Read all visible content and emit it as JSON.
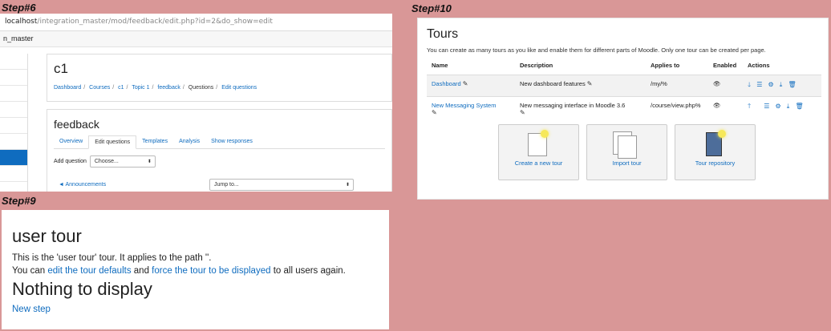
{
  "labels": {
    "step6": "Step#6",
    "step10": "Step#10",
    "step9": "Step#9"
  },
  "step6": {
    "url_host": "localhost",
    "url_path": "/integration_master/mod/feedback/edit.php?id=2&do_show=edit",
    "tab_title": "n_master",
    "course_title": "c1",
    "breadcrumbs": [
      "Dashboard",
      "Courses",
      "c1",
      "Topic 1",
      "feedback",
      "Questions",
      "Edit questions"
    ],
    "activity_title": "feedback",
    "tabs": [
      "Overview",
      "Edit questions",
      "Templates",
      "Analysis",
      "Show responses"
    ],
    "add_question_label": "Add question",
    "add_question_select": "Choose...",
    "prev_link": "◄ Announcements",
    "jump_select": "Jump to..."
  },
  "step10": {
    "title": "Tours",
    "intro": "You can create as many tours as you like and enable them for different parts of Moodle. Only one tour can be created per page.",
    "headers": [
      "Name",
      "Description",
      "Applies to",
      "Enabled",
      "Actions"
    ],
    "rows": [
      {
        "name": "Dashboard",
        "description": "New dashboard features",
        "applies_to": "/my/%"
      },
      {
        "name": "New Messaging System",
        "description": "New messaging interface in Moodle 3.6",
        "applies_to": "/course/view.php%"
      }
    ],
    "buttons": [
      "Create a new tour",
      "Import tour",
      "Tour repository"
    ],
    "icons": {
      "pencil": "pencil-icon",
      "eye": "eye-icon",
      "down": "arrow-down-icon",
      "up": "arrow-up-icon",
      "list": "list-icon",
      "gear": "gear-icon",
      "export": "download-icon",
      "delete": "trash-icon"
    },
    "accent": "#0f6cbf"
  },
  "step9": {
    "title": "user tour",
    "line1": "This is the 'user tour' tour. It applies to the path ''.",
    "line2_pre": "You can",
    "line2_link1": "edit the tour defaults",
    "line2_mid": "and",
    "line2_link2": "force the tour to be displayed",
    "line2_post": "to all users again.",
    "empty_heading": "Nothing to display",
    "new_step": "New step"
  }
}
